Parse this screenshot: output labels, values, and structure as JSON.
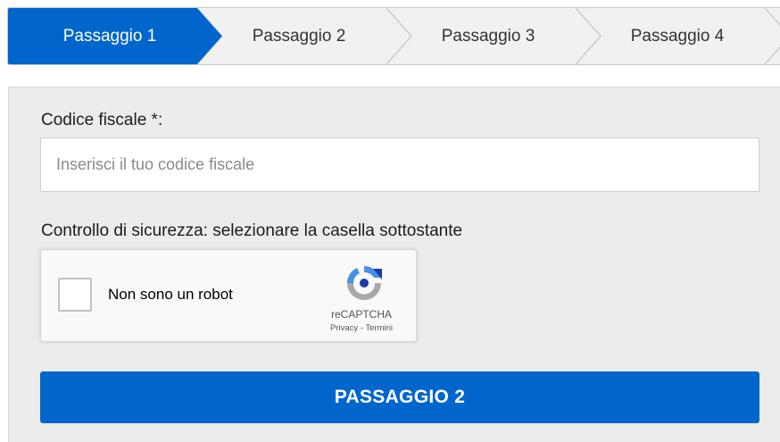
{
  "stepper": {
    "steps": [
      {
        "label": "Passaggio 1",
        "active": true
      },
      {
        "label": "Passaggio 2",
        "active": false
      },
      {
        "label": "Passaggio 3",
        "active": false
      },
      {
        "label": "Passaggio 4",
        "active": false
      }
    ]
  },
  "form": {
    "codice_fiscale": {
      "label": "Codice fiscale *:",
      "value": "",
      "placeholder": "Inserisci il tuo codice fiscale"
    },
    "security": {
      "label": "Controllo di sicurezza: selezionare la casella sottostante"
    },
    "recaptcha": {
      "checkbox_label": "Non sono un robot",
      "checked": false,
      "brand": "reCAPTCHA",
      "privacy_link": "Privacy",
      "separator": " - ",
      "terms_link": "Termini",
      "logo_icon": "recaptcha-logo-icon"
    },
    "submit_label": "PASSAGGIO 2"
  },
  "colors": {
    "primary": "#0066cc",
    "active_step": "#0066cc",
    "inactive_step": "#f1f1f1",
    "panel_background": "#ececec"
  }
}
